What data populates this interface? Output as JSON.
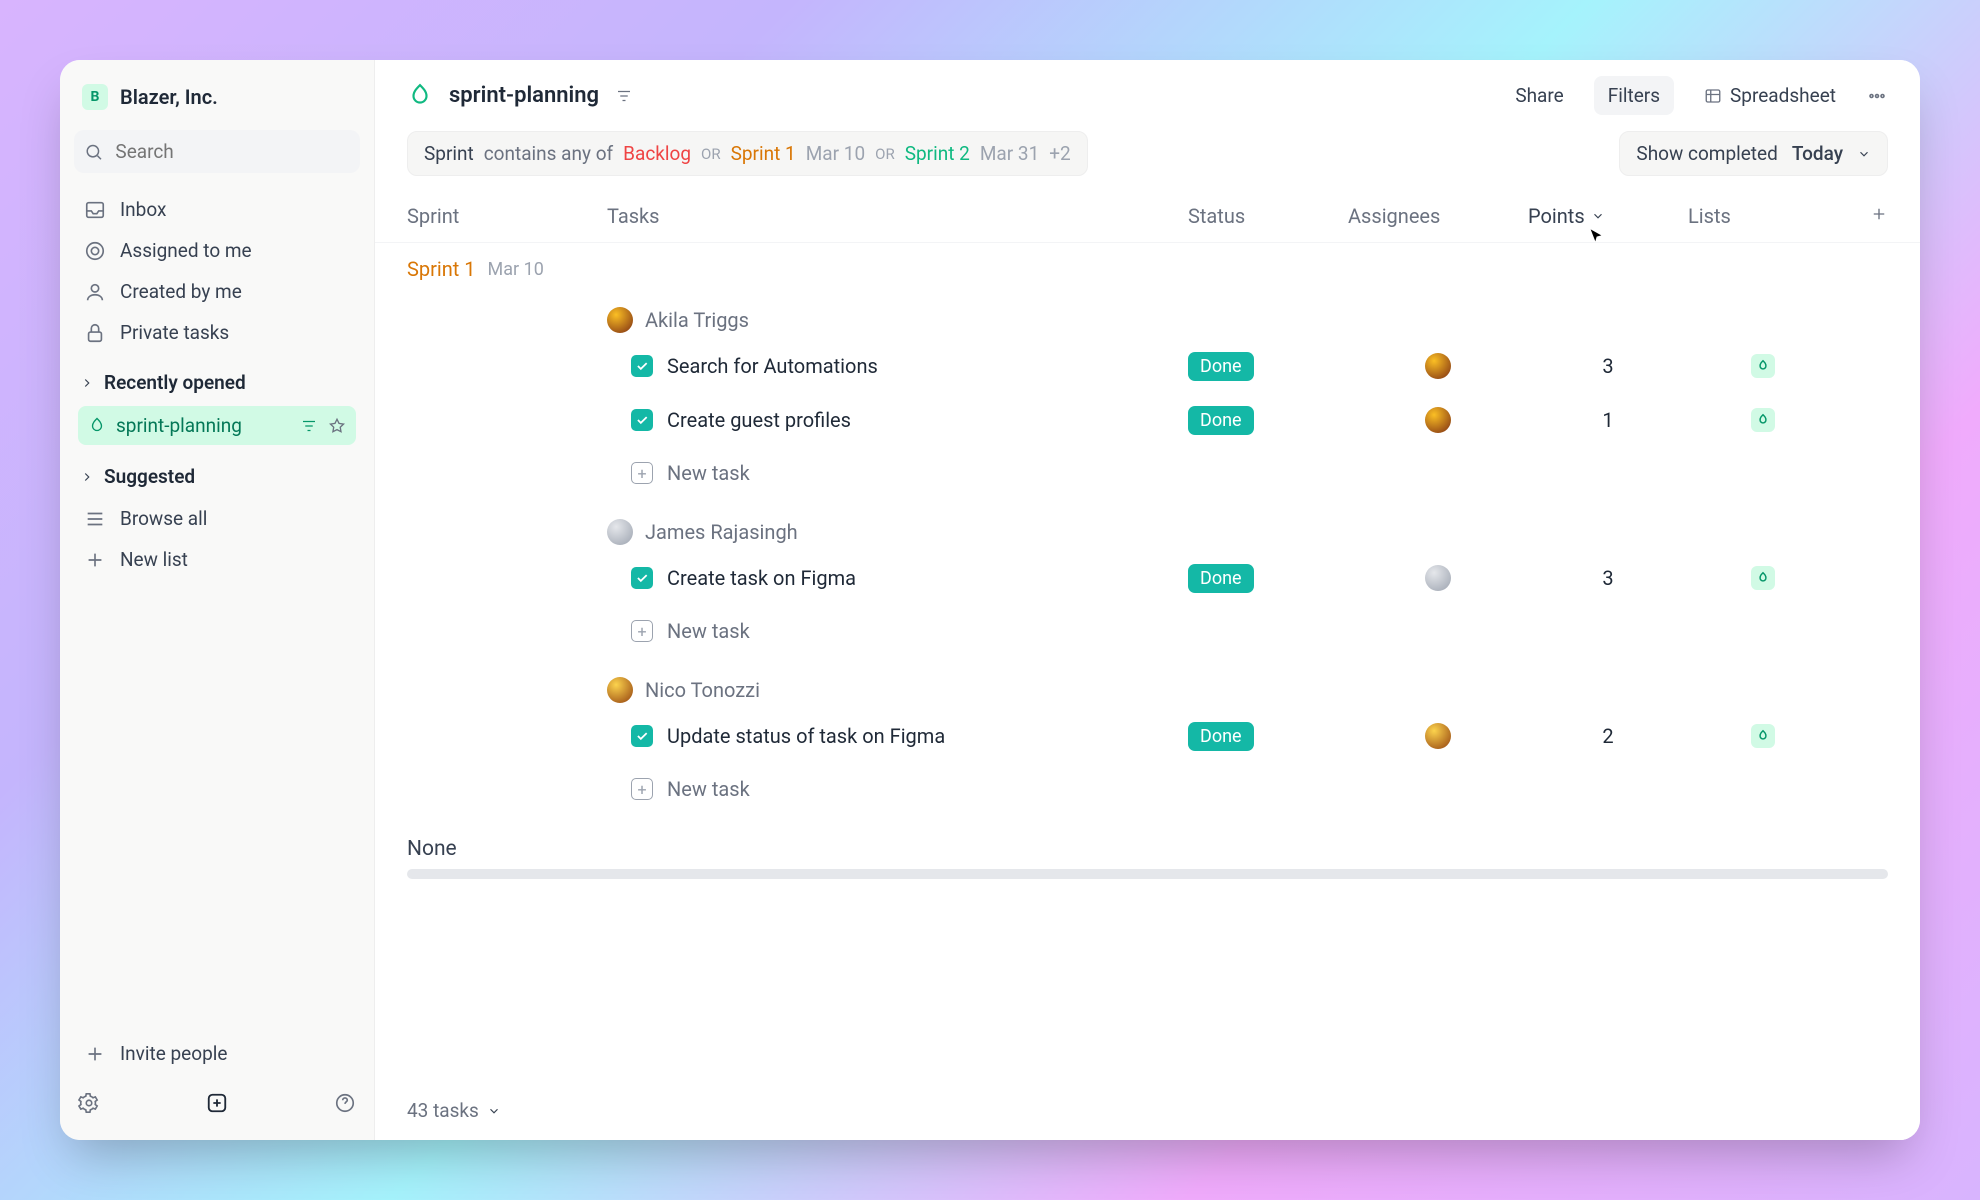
{
  "org": {
    "initial": "B",
    "name": "Blazer, Inc."
  },
  "search": {
    "placeholder": "Search"
  },
  "nav": {
    "inbox": "Inbox",
    "assigned": "Assigned to me",
    "created": "Created by me",
    "private": "Private tasks",
    "recent": "Recently opened",
    "suggested": "Suggested",
    "browse": "Browse all",
    "newlist": "New list",
    "invite": "Invite people"
  },
  "active_list": {
    "name": "sprint-planning"
  },
  "topbar": {
    "title": "sprint-planning",
    "share": "Share",
    "filters": "Filters",
    "spreadsheet": "Spreadsheet"
  },
  "filter": {
    "field": "Sprint",
    "op": "contains any of",
    "backlog": "Backlog",
    "or": "OR",
    "s1": "Sprint 1",
    "s1_date": "Mar 10",
    "s2": "Sprint 2",
    "s2_date": "Mar 31",
    "more": "+2",
    "show_completed": "Show completed",
    "today": "Today"
  },
  "columns": {
    "sprint": "Sprint",
    "tasks": "Tasks",
    "status": "Status",
    "assignees": "Assignees",
    "points": "Points",
    "lists": "Lists"
  },
  "sprint_header": {
    "label": "Sprint 1",
    "date": "Mar 10"
  },
  "groups": [
    {
      "name": "Akila Triggs",
      "avatar": "av1",
      "tasks": [
        {
          "title": "Search for Automations",
          "status": "Done",
          "points": "3"
        },
        {
          "title": "Create guest profiles",
          "status": "Done",
          "points": "1"
        }
      ]
    },
    {
      "name": "James Rajasingh",
      "avatar": "av2",
      "tasks": [
        {
          "title": "Create task on Figma",
          "status": "Done",
          "points": "3"
        }
      ]
    },
    {
      "name": "Nico Tonozzi",
      "avatar": "av3",
      "tasks": [
        {
          "title": "Update status of task on Figma",
          "status": "Done",
          "points": "2"
        }
      ]
    }
  ],
  "new_task": "New task",
  "none": "None",
  "footer": {
    "count": "43 tasks"
  }
}
